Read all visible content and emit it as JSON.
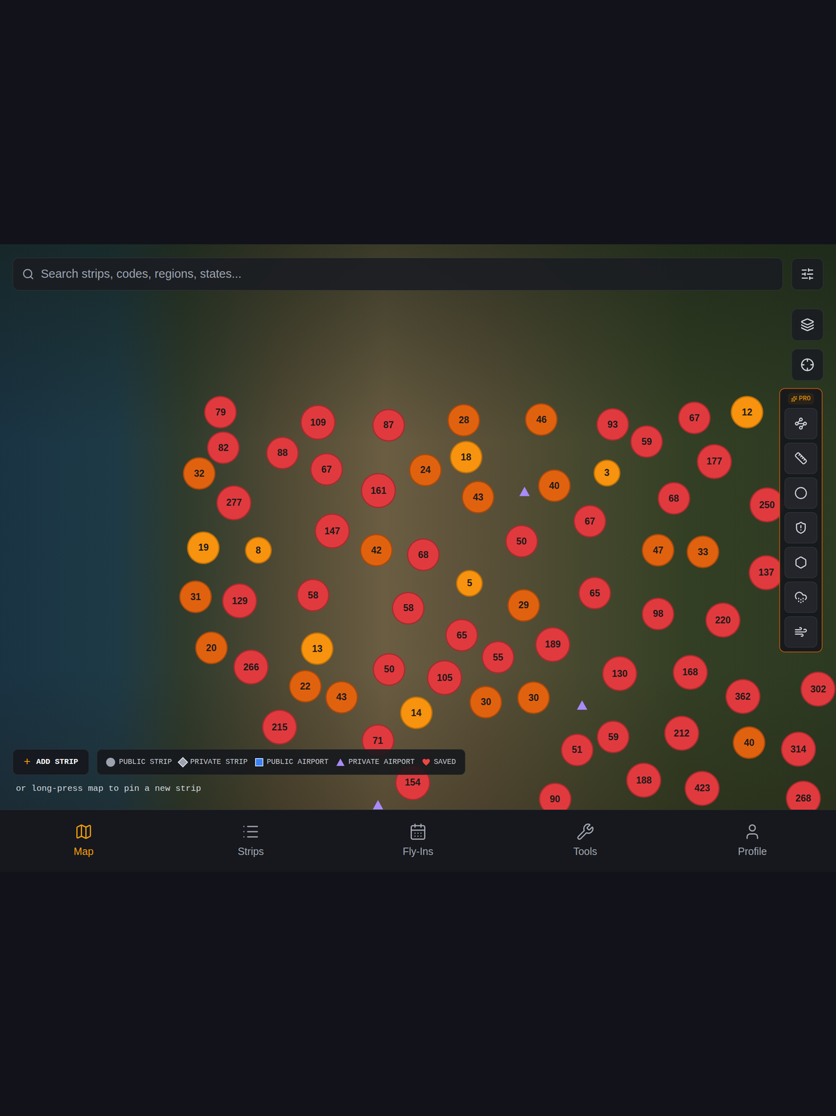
{
  "search": {
    "placeholder": "Search strips, codes, regions, states..."
  },
  "toolbar": {
    "badge": "PRO"
  },
  "clusters": [
    {
      "count": "79",
      "color": "#e03a3e"
    },
    {
      "count": "82",
      "color": "#e03a3e"
    },
    {
      "count": "32",
      "color": "#e0620f"
    },
    {
      "count": "109",
      "color": "#e03a3e"
    },
    {
      "count": "88",
      "color": "#e03a3e"
    },
    {
      "count": "67",
      "color": "#e03a3e"
    },
    {
      "count": "87",
      "color": "#e03a3e"
    },
    {
      "count": "28",
      "color": "#e0620f"
    },
    {
      "count": "18",
      "color": "#f7930e"
    },
    {
      "count": "24",
      "color": "#e0620f"
    },
    {
      "count": "161",
      "color": "#e03a3e"
    },
    {
      "count": "43",
      "color": "#e0620f"
    },
    {
      "count": "46",
      "color": "#e0620f"
    },
    {
      "count": "40",
      "color": "#e0620f"
    },
    {
      "count": "93",
      "color": "#e03a3e"
    },
    {
      "count": "59",
      "color": "#e03a3e"
    },
    {
      "count": "3",
      "color": "#f7930e"
    },
    {
      "count": "67",
      "color": "#e03a3e"
    },
    {
      "count": "12",
      "color": "#f7930e"
    },
    {
      "count": "177",
      "color": "#e03a3e"
    },
    {
      "count": "68",
      "color": "#e03a3e"
    },
    {
      "count": "250",
      "color": "#e03a3e"
    },
    {
      "count": "277",
      "color": "#e03a3e"
    },
    {
      "count": "19",
      "color": "#f7930e"
    },
    {
      "count": "8",
      "color": "#f7930e"
    },
    {
      "count": "147",
      "color": "#e03a3e"
    },
    {
      "count": "42",
      "color": "#e0620f"
    },
    {
      "count": "68",
      "color": "#e03a3e"
    },
    {
      "count": "50",
      "color": "#e03a3e"
    },
    {
      "count": "67",
      "color": "#e03a3e"
    },
    {
      "count": "47",
      "color": "#e0620f"
    },
    {
      "count": "33",
      "color": "#e0620f"
    },
    {
      "count": "137",
      "color": "#e03a3e"
    },
    {
      "count": "31",
      "color": "#e0620f"
    },
    {
      "count": "129",
      "color": "#e03a3e"
    },
    {
      "count": "58",
      "color": "#e03a3e"
    },
    {
      "count": "5",
      "color": "#f7930e"
    },
    {
      "count": "58",
      "color": "#e03a3e"
    },
    {
      "count": "29",
      "color": "#e0620f"
    },
    {
      "count": "65",
      "color": "#e03a3e"
    },
    {
      "count": "98",
      "color": "#e03a3e"
    },
    {
      "count": "220",
      "color": "#e03a3e"
    },
    {
      "count": "20",
      "color": "#e0620f"
    },
    {
      "count": "13",
      "color": "#f7930e"
    },
    {
      "count": "266",
      "color": "#e03a3e"
    },
    {
      "count": "65",
      "color": "#e03a3e"
    },
    {
      "count": "55",
      "color": "#e03a3e"
    },
    {
      "count": "189",
      "color": "#e03a3e"
    },
    {
      "count": "50",
      "color": "#e03a3e"
    },
    {
      "count": "105",
      "color": "#e03a3e"
    },
    {
      "count": "22",
      "color": "#e0620f"
    },
    {
      "count": "43",
      "color": "#e0620f"
    },
    {
      "count": "30",
      "color": "#e0620f"
    },
    {
      "count": "30",
      "color": "#e0620f"
    },
    {
      "count": "130",
      "color": "#e03a3e"
    },
    {
      "count": "168",
      "color": "#e03a3e"
    },
    {
      "count": "362",
      "color": "#e03a3e"
    },
    {
      "count": "302",
      "color": "#e03a3e"
    },
    {
      "count": "14",
      "color": "#f7930e"
    },
    {
      "count": "215",
      "color": "#e03a3e"
    },
    {
      "count": "71",
      "color": "#e03a3e"
    },
    {
      "count": "59",
      "color": "#e03a3e"
    },
    {
      "count": "51",
      "color": "#e03a3e"
    },
    {
      "count": "212",
      "color": "#e03a3e"
    },
    {
      "count": "40",
      "color": "#e0620f"
    },
    {
      "count": "314",
      "color": "#e03a3e"
    },
    {
      "count": "188",
      "color": "#e03a3e"
    },
    {
      "count": "423",
      "color": "#e03a3e"
    },
    {
      "count": "268",
      "color": "#e03a3e"
    },
    {
      "count": "90",
      "color": "#e03a3e"
    },
    {
      "count": "154",
      "color": "#e03a3e"
    }
  ],
  "add_strip": {
    "icon": "+",
    "label": "ADD STRIP"
  },
  "legend": [
    {
      "label": "PUBLIC STRIP",
      "kind": "circle",
      "color": "#9ca3af"
    },
    {
      "label": "PRIVATE STRIP",
      "kind": "diamond",
      "color": "#9ca3af"
    },
    {
      "label": "PUBLIC AIRPORT",
      "kind": "square",
      "color": "#3b82f6"
    },
    {
      "label": "PRIVATE AIRPORT",
      "kind": "triangle",
      "color": "#a78bfa"
    },
    {
      "label": "SAVED",
      "kind": "heart",
      "color": "#ef4444"
    }
  ],
  "hint": "or long-press map to pin a new strip",
  "nav": [
    {
      "label": "Map",
      "selected": true
    },
    {
      "label": "Strips",
      "selected": false
    },
    {
      "label": "Fly-Ins",
      "selected": false
    },
    {
      "label": "Tools",
      "selected": false
    },
    {
      "label": "Profile",
      "selected": false
    }
  ]
}
